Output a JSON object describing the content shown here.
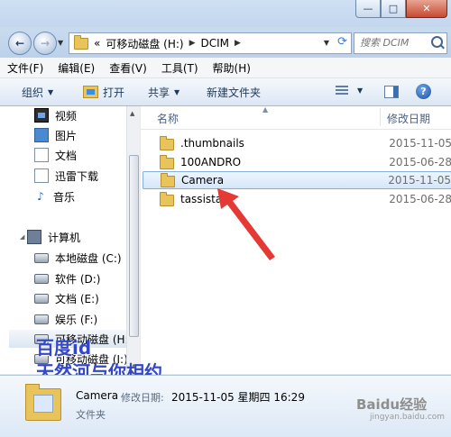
{
  "window": {
    "buttons": {
      "minimize": "—",
      "maximize": "□",
      "close": "✕"
    }
  },
  "address": {
    "overflow": "«",
    "crumbs": [
      "可移动磁盘 (H:)",
      "DCIM"
    ],
    "search_placeholder": "搜索 DCIM",
    "refresh": "⟳"
  },
  "menu": [
    "文件(F)",
    "编辑(E)",
    "查看(V)",
    "工具(T)",
    "帮助(H)"
  ],
  "toolbar": {
    "organize": "组织",
    "open": "打开",
    "share": "共享",
    "new_folder": "新建文件夹",
    "help": "?"
  },
  "nav": {
    "libraries": [
      "视频",
      "图片",
      "文档",
      "迅雷下载",
      "音乐"
    ],
    "computer": "计算机",
    "drives": [
      "本地磁盘 (C:)",
      "软件 (D:)",
      "文档 (E:)",
      "娱乐 (F:)",
      "可移动磁盘 (H:)",
      "可移动磁盘 (I:)"
    ]
  },
  "columns": {
    "name": "名称",
    "date": "修改日期"
  },
  "files": [
    {
      "name": ".thumbnails",
      "date": "2015-11-05"
    },
    {
      "name": "100ANDRO",
      "date": "2015-06-28"
    },
    {
      "name": "Camera",
      "date": "2015-11-05",
      "selected": true
    },
    {
      "name": "tassistant",
      "date": "2015-06-28"
    }
  ],
  "details": {
    "name": "Camera",
    "modified_label": "修改日期:",
    "modified_value": "2015-11-05 星期四 16:29",
    "type": "文件夹"
  },
  "watermark": {
    "line1": "百度id",
    "line2": "天然河与你相约",
    "logo": "Baidu经验",
    "sub": "jingyan.baidu.com"
  },
  "colors": {
    "annotation_arrow": "#e53935",
    "watermark": "#3447c9",
    "selection": "#84acdd"
  }
}
